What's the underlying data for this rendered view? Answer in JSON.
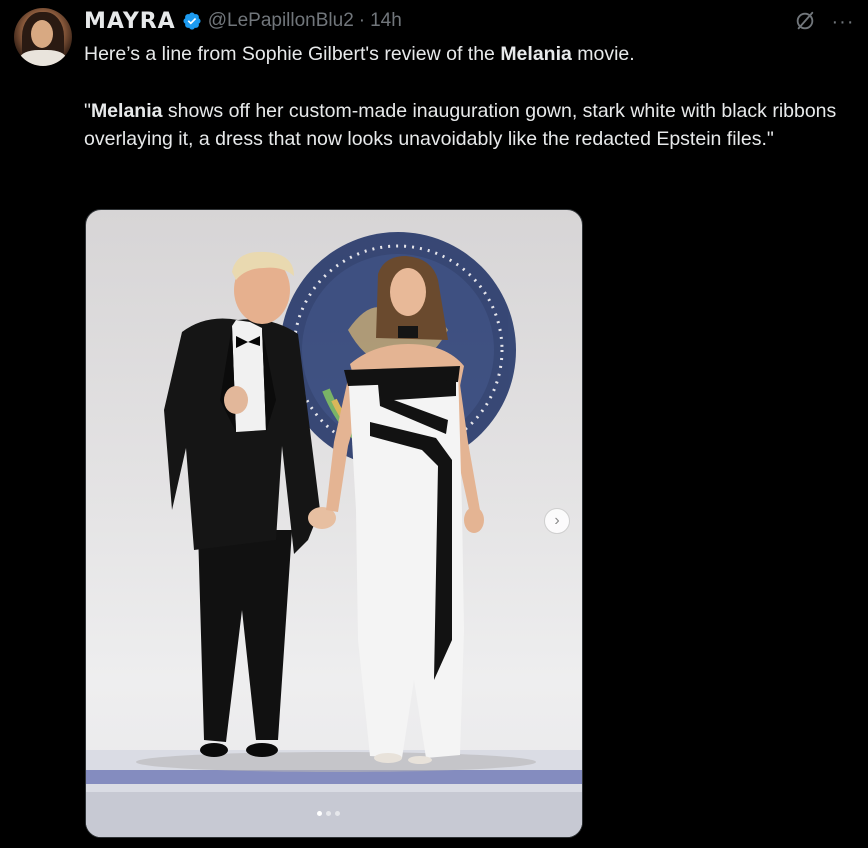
{
  "author": {
    "display_name": "MAYRA",
    "handle": "@LePapillonBlu2",
    "separator": "·",
    "timestamp": "14h",
    "verified": true,
    "verified_color": "#1d9bf0"
  },
  "tweet": {
    "line1_before": "Here’s a line from Sophie Gilbert's review of the ",
    "line1_bold": "Melania",
    "line1_after": " movie.",
    "quote_open": "\"",
    "quote_bold": "Melania",
    "quote_rest": " shows off her custom-made inauguration gown, stark white with black ribbons overlaying it, a dress that now looks unavoidably like the redacted Epstein files.\""
  },
  "actions": {
    "grok_icon": "grok-icon",
    "more_icon": "more-icon",
    "more_label": "···"
  },
  "media": {
    "next_label": "›",
    "pager_total": 3,
    "pager_active": 1
  },
  "colors": {
    "background": "#000000",
    "text": "#e7e9ea",
    "muted": "#71767b",
    "border": "#2f3336"
  }
}
